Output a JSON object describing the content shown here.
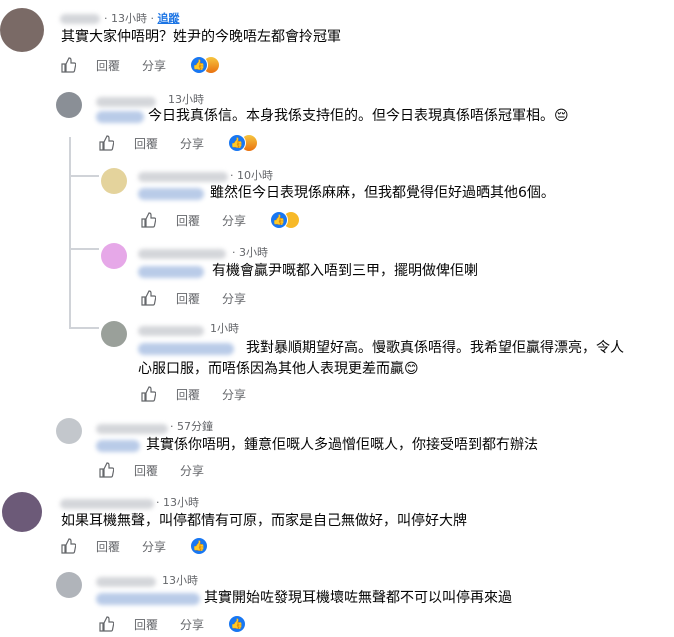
{
  "colors": {
    "link": "#1b74e4",
    "meta": "#65676b",
    "text": "#050505",
    "like": "#1877f2"
  },
  "actions": {
    "reply": "回覆",
    "share": "分享",
    "follow": "追蹤"
  },
  "comments": [
    {
      "time": "· 13小時 ·",
      "text": "其實大家仲唔明？姓尹的今晚唔左都會拎冠軍",
      "reactions": [
        "like",
        "angry"
      ],
      "avatar_color": "#7a6a66",
      "follow": true
    },
    {
      "time": "13小時",
      "text": "今日我真係信。本身我係支持佢的。但今日表現真係唔係冠軍相。😔",
      "reactions": [
        "like",
        "angry"
      ],
      "avatar_color": "#8a8f96"
    },
    {
      "time": "· 10小時",
      "text": "雖然佢今日表現係麻麻，但我都覺得佢好過晒其他6個。",
      "reactions": [
        "like",
        "haha"
      ],
      "avatar_color": "#e4d39c"
    },
    {
      "time": "· 3小時",
      "text": "有機會贏尹嘅都入唔到三甲，擺明做俾佢喇",
      "reactions": [],
      "avatar_color": "#e6a8e8"
    },
    {
      "time": "1小時",
      "text_line1": "我對暴順期望好高。慢歌真係唔得。我希望佢贏得漂亮，令人",
      "text_line2": "心服口服，而唔係因為其他人表現更差而贏😊",
      "reactions": [],
      "avatar_color": "#9aa09a"
    },
    {
      "time": "· 57分鐘",
      "text": "其實係你唔明，鍾意佢嘅人多過憎佢嘅人，你接受唔到都冇辦法",
      "reactions": [],
      "avatar_color": "#c3c7cc"
    },
    {
      "time": "· 13小時",
      "text": "如果耳機無聲，叫停都情有可原，而家是自己無做好，叫停好大牌",
      "reactions": [
        "like"
      ],
      "avatar_color": "#6c5a78"
    },
    {
      "time": "13小時",
      "text": "其實開始咗發現耳機壞咗無聲都不可以叫停再來過",
      "reactions": [
        "like"
      ],
      "avatar_color": "#b0b4ba"
    }
  ]
}
